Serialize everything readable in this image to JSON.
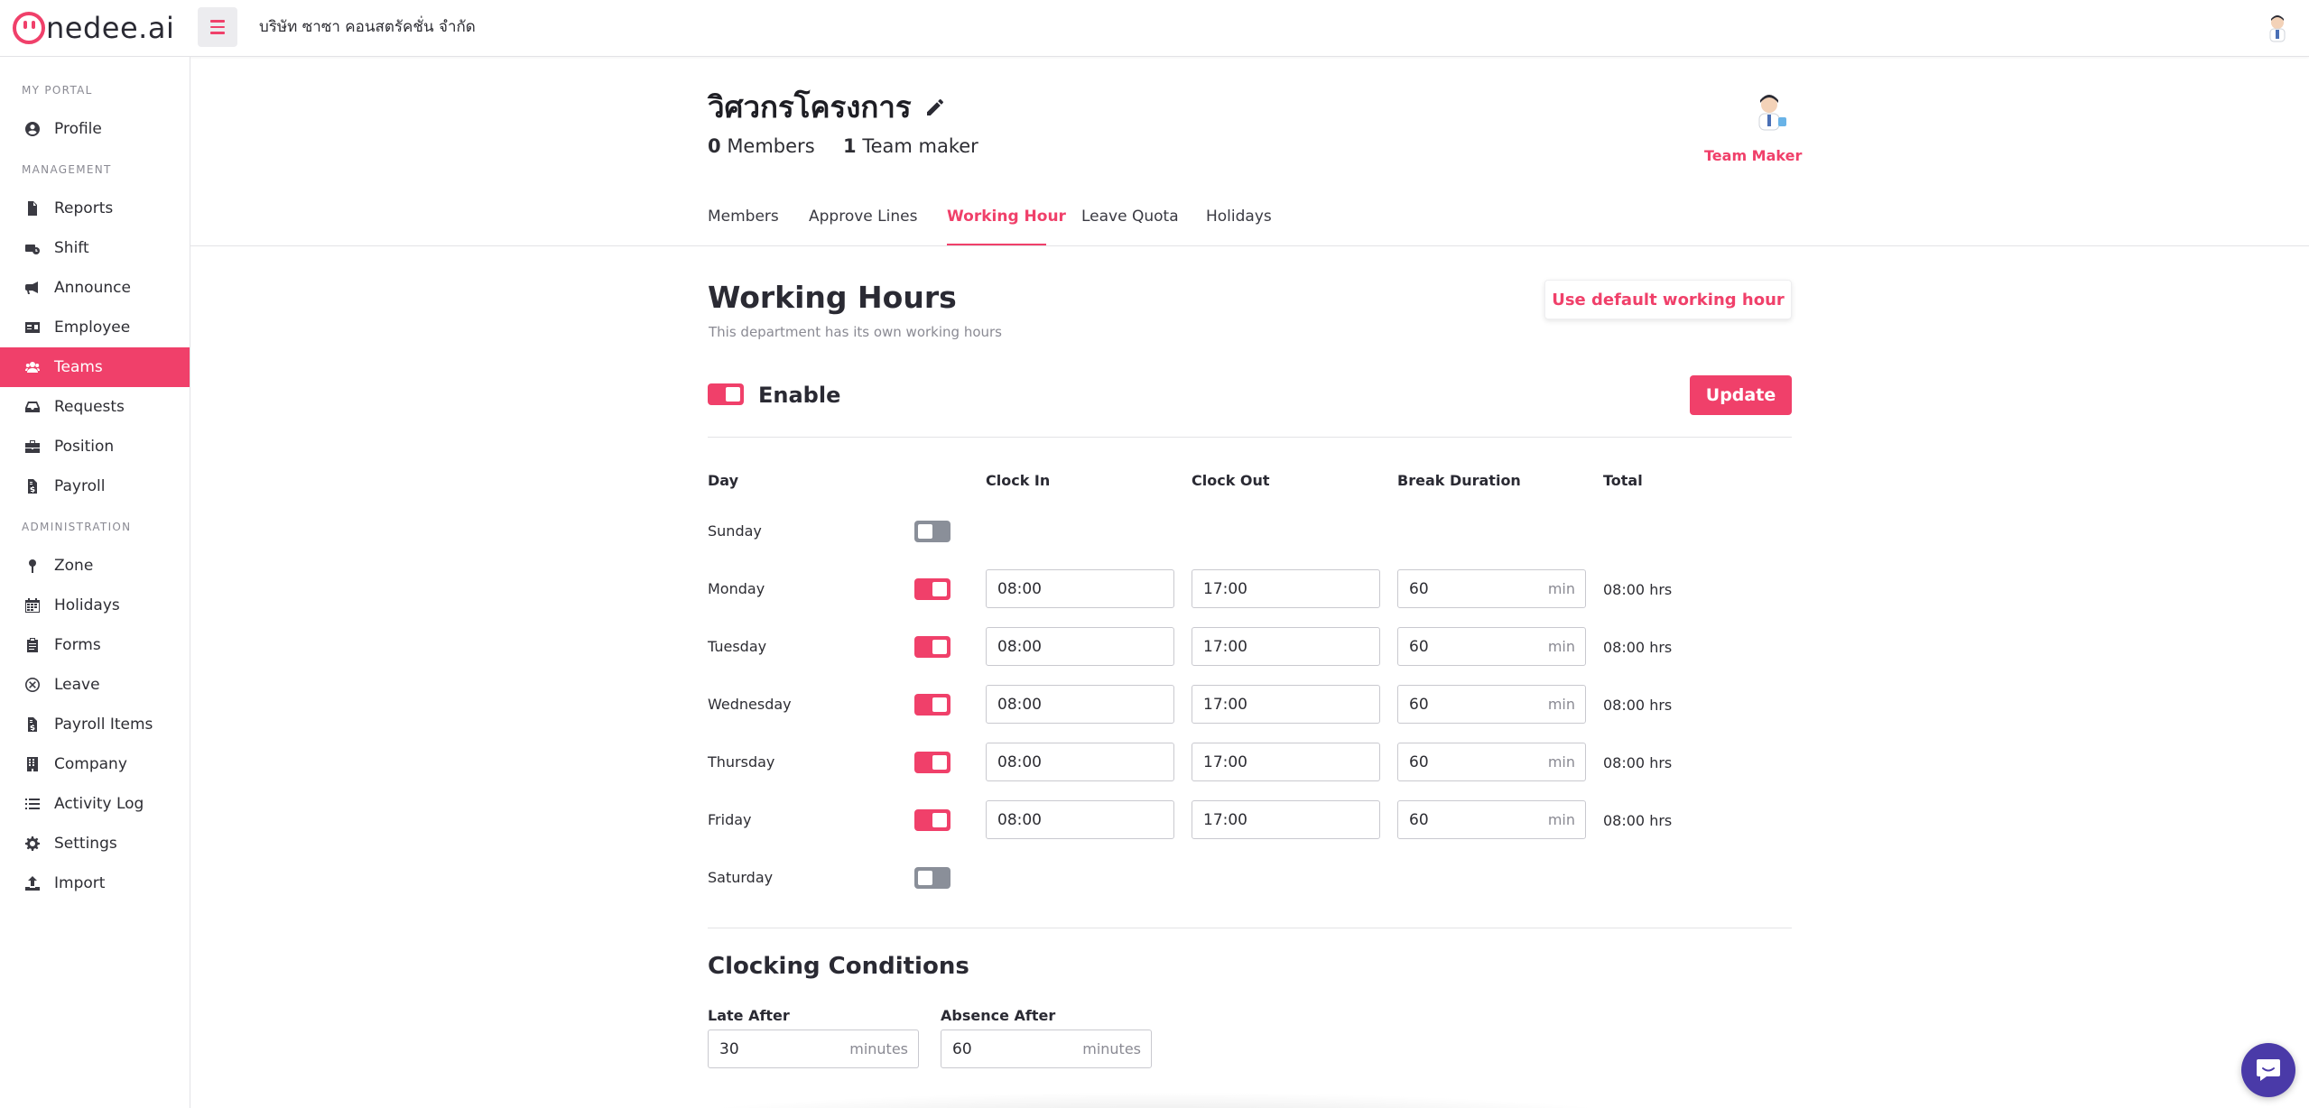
{
  "app": {
    "logo_text": "nedee.ai",
    "company_name": "บริษัท ซาซา คอนสตรัคชั่น จำกัด"
  },
  "sidebar": {
    "sections": {
      "my_portal": "MY PORTAL",
      "management": "MANAGEMENT",
      "administration": "ADMINISTRATION"
    },
    "items": [
      {
        "label": "Profile",
        "icon": "user-circle-icon"
      },
      {
        "label": "Reports",
        "icon": "document-icon"
      },
      {
        "label": "Shift",
        "icon": "shift-icon"
      },
      {
        "label": "Announce",
        "icon": "megaphone-icon"
      },
      {
        "label": "Employee",
        "icon": "id-card-icon"
      },
      {
        "label": "Teams",
        "icon": "users-icon",
        "active": true
      },
      {
        "label": "Requests",
        "icon": "inbox-icon"
      },
      {
        "label": "Position",
        "icon": "briefcase-icon"
      },
      {
        "label": "Payroll",
        "icon": "invoice-icon"
      },
      {
        "label": "Zone",
        "icon": "pin-icon"
      },
      {
        "label": "Holidays",
        "icon": "calendar-icon"
      },
      {
        "label": "Forms",
        "icon": "clipboard-icon"
      },
      {
        "label": "Leave",
        "icon": "cancel-circle-icon"
      },
      {
        "label": "Payroll Items",
        "icon": "invoice-icon"
      },
      {
        "label": "Company",
        "icon": "building-icon"
      },
      {
        "label": "Activity Log",
        "icon": "list-icon"
      },
      {
        "label": "Settings",
        "icon": "gear-icon"
      },
      {
        "label": "Import",
        "icon": "upload-icon"
      }
    ]
  },
  "team": {
    "name": "วิศวกรโครงการ",
    "members_count": "0",
    "members_label": "Members",
    "team_maker_count": "1",
    "team_maker_label": "Team maker",
    "maker_role": "Team Maker"
  },
  "tabs": [
    "Members",
    "Approve Lines",
    "Working Hour",
    "Leave Quota",
    "Holidays"
  ],
  "active_tab": "Working Hour",
  "working_hours": {
    "title": "Working Hours",
    "subtitle": "This department has its own working hours",
    "default_button": "Use default working hour",
    "enable_label": "Enable",
    "enabled": true,
    "update_button": "Update",
    "columns": [
      "Day",
      "Clock In",
      "Clock Out",
      "Break Duration",
      "Total"
    ],
    "break_unit": "min",
    "days": [
      {
        "day": "Sunday",
        "enabled": false
      },
      {
        "day": "Monday",
        "enabled": true,
        "clock_in": "08:00",
        "clock_out": "17:00",
        "break": "60",
        "total": "08:00 hrs"
      },
      {
        "day": "Tuesday",
        "enabled": true,
        "clock_in": "08:00",
        "clock_out": "17:00",
        "break": "60",
        "total": "08:00 hrs"
      },
      {
        "day": "Wednesday",
        "enabled": true,
        "clock_in": "08:00",
        "clock_out": "17:00",
        "break": "60",
        "total": "08:00 hrs"
      },
      {
        "day": "Thursday",
        "enabled": true,
        "clock_in": "08:00",
        "clock_out": "17:00",
        "break": "60",
        "total": "08:00 hrs"
      },
      {
        "day": "Friday",
        "enabled": true,
        "clock_in": "08:00",
        "clock_out": "17:00",
        "break": "60",
        "total": "08:00 hrs"
      },
      {
        "day": "Saturday",
        "enabled": false
      }
    ]
  },
  "clocking": {
    "title": "Clocking Conditions",
    "late_after_label": "Late After",
    "late_after_value": "30",
    "absence_after_label": "Absence After",
    "absence_after_value": "60",
    "unit": "minutes"
  },
  "colors": {
    "accent": "#f0406a",
    "toggle_off": "#8a8f99",
    "chat": "#4a3aa8"
  }
}
